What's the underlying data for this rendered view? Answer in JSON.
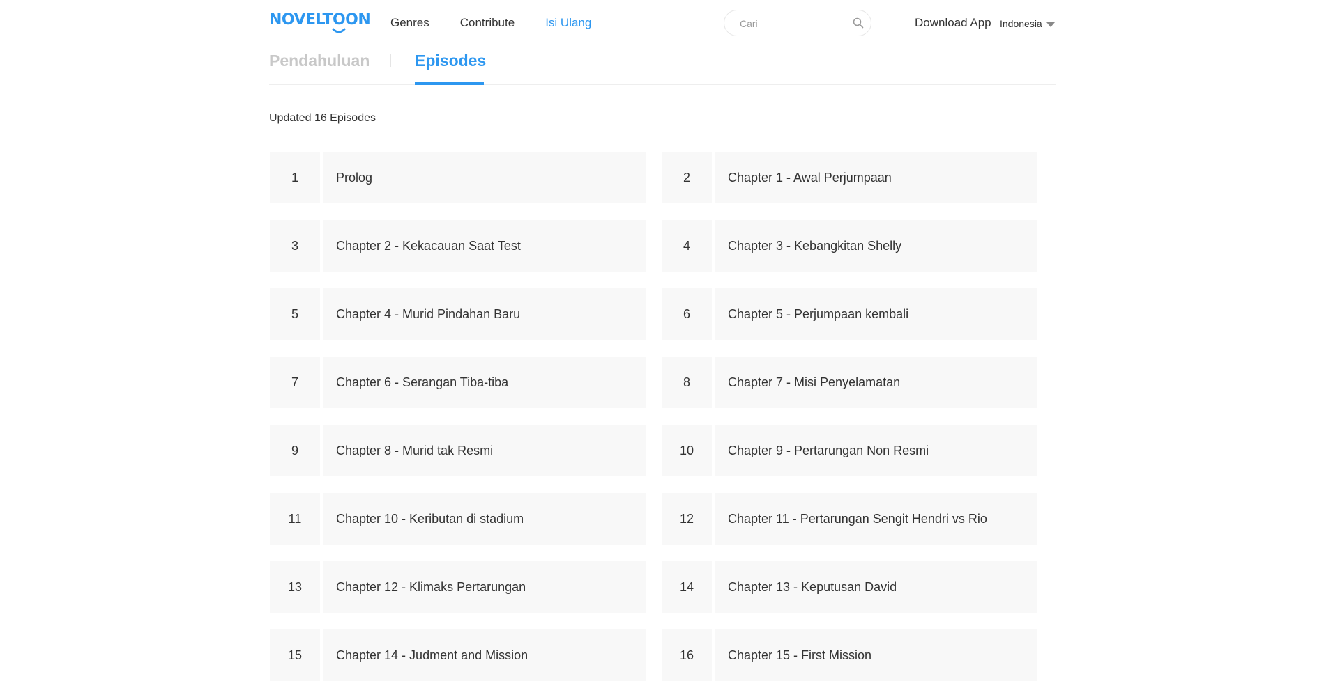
{
  "header": {
    "logo_text": "NOVELTOON",
    "nav": [
      {
        "label": "Genres",
        "active": false
      },
      {
        "label": "Contribute",
        "active": false
      },
      {
        "label": "Isi Ulang",
        "active": true
      }
    ],
    "search_placeholder": "Cari",
    "search_value": "",
    "download_label": "Download App",
    "language": "Indonesia"
  },
  "tabs": {
    "intro": "Pendahuluan",
    "episodes": "Episodes",
    "active": "episodes"
  },
  "updated_text": "Updated 16 Episodes",
  "episodes": [
    {
      "num": "1",
      "title": "Prolog"
    },
    {
      "num": "2",
      "title": "Chapter 1 - Awal Perjumpaan"
    },
    {
      "num": "3",
      "title": "Chapter 2 - Kekacauan Saat Test"
    },
    {
      "num": "4",
      "title": "Chapter 3 - Kebangkitan Shelly"
    },
    {
      "num": "5",
      "title": "Chapter 4 - Murid Pindahan Baru"
    },
    {
      "num": "6",
      "title": "Chapter 5 - Perjumpaan kembali"
    },
    {
      "num": "7",
      "title": "Chapter 6 - Serangan Tiba-tiba"
    },
    {
      "num": "8",
      "title": "Chapter 7 - Misi Penyelamatan"
    },
    {
      "num": "9",
      "title": "Chapter 8 - Murid tak Resmi"
    },
    {
      "num": "10",
      "title": "Chapter 9 - Pertarungan Non Resmi"
    },
    {
      "num": "11",
      "title": "Chapter 10 - Keributan di stadium"
    },
    {
      "num": "12",
      "title": "Chapter 11 - Pertarungan Sengit Hendri vs Rio"
    },
    {
      "num": "13",
      "title": "Chapter 12 - Klimaks Pertarungan"
    },
    {
      "num": "14",
      "title": "Chapter 13 - Keputusan David"
    },
    {
      "num": "15",
      "title": "Chapter 14 - Judment and Mission"
    },
    {
      "num": "16",
      "title": "Chapter 15 - First Mission"
    }
  ],
  "colors": {
    "accent": "#2d97f0",
    "card_bg": "#f8f8f8",
    "inactive_tab": "#c8c8c8",
    "text": "#333333"
  }
}
